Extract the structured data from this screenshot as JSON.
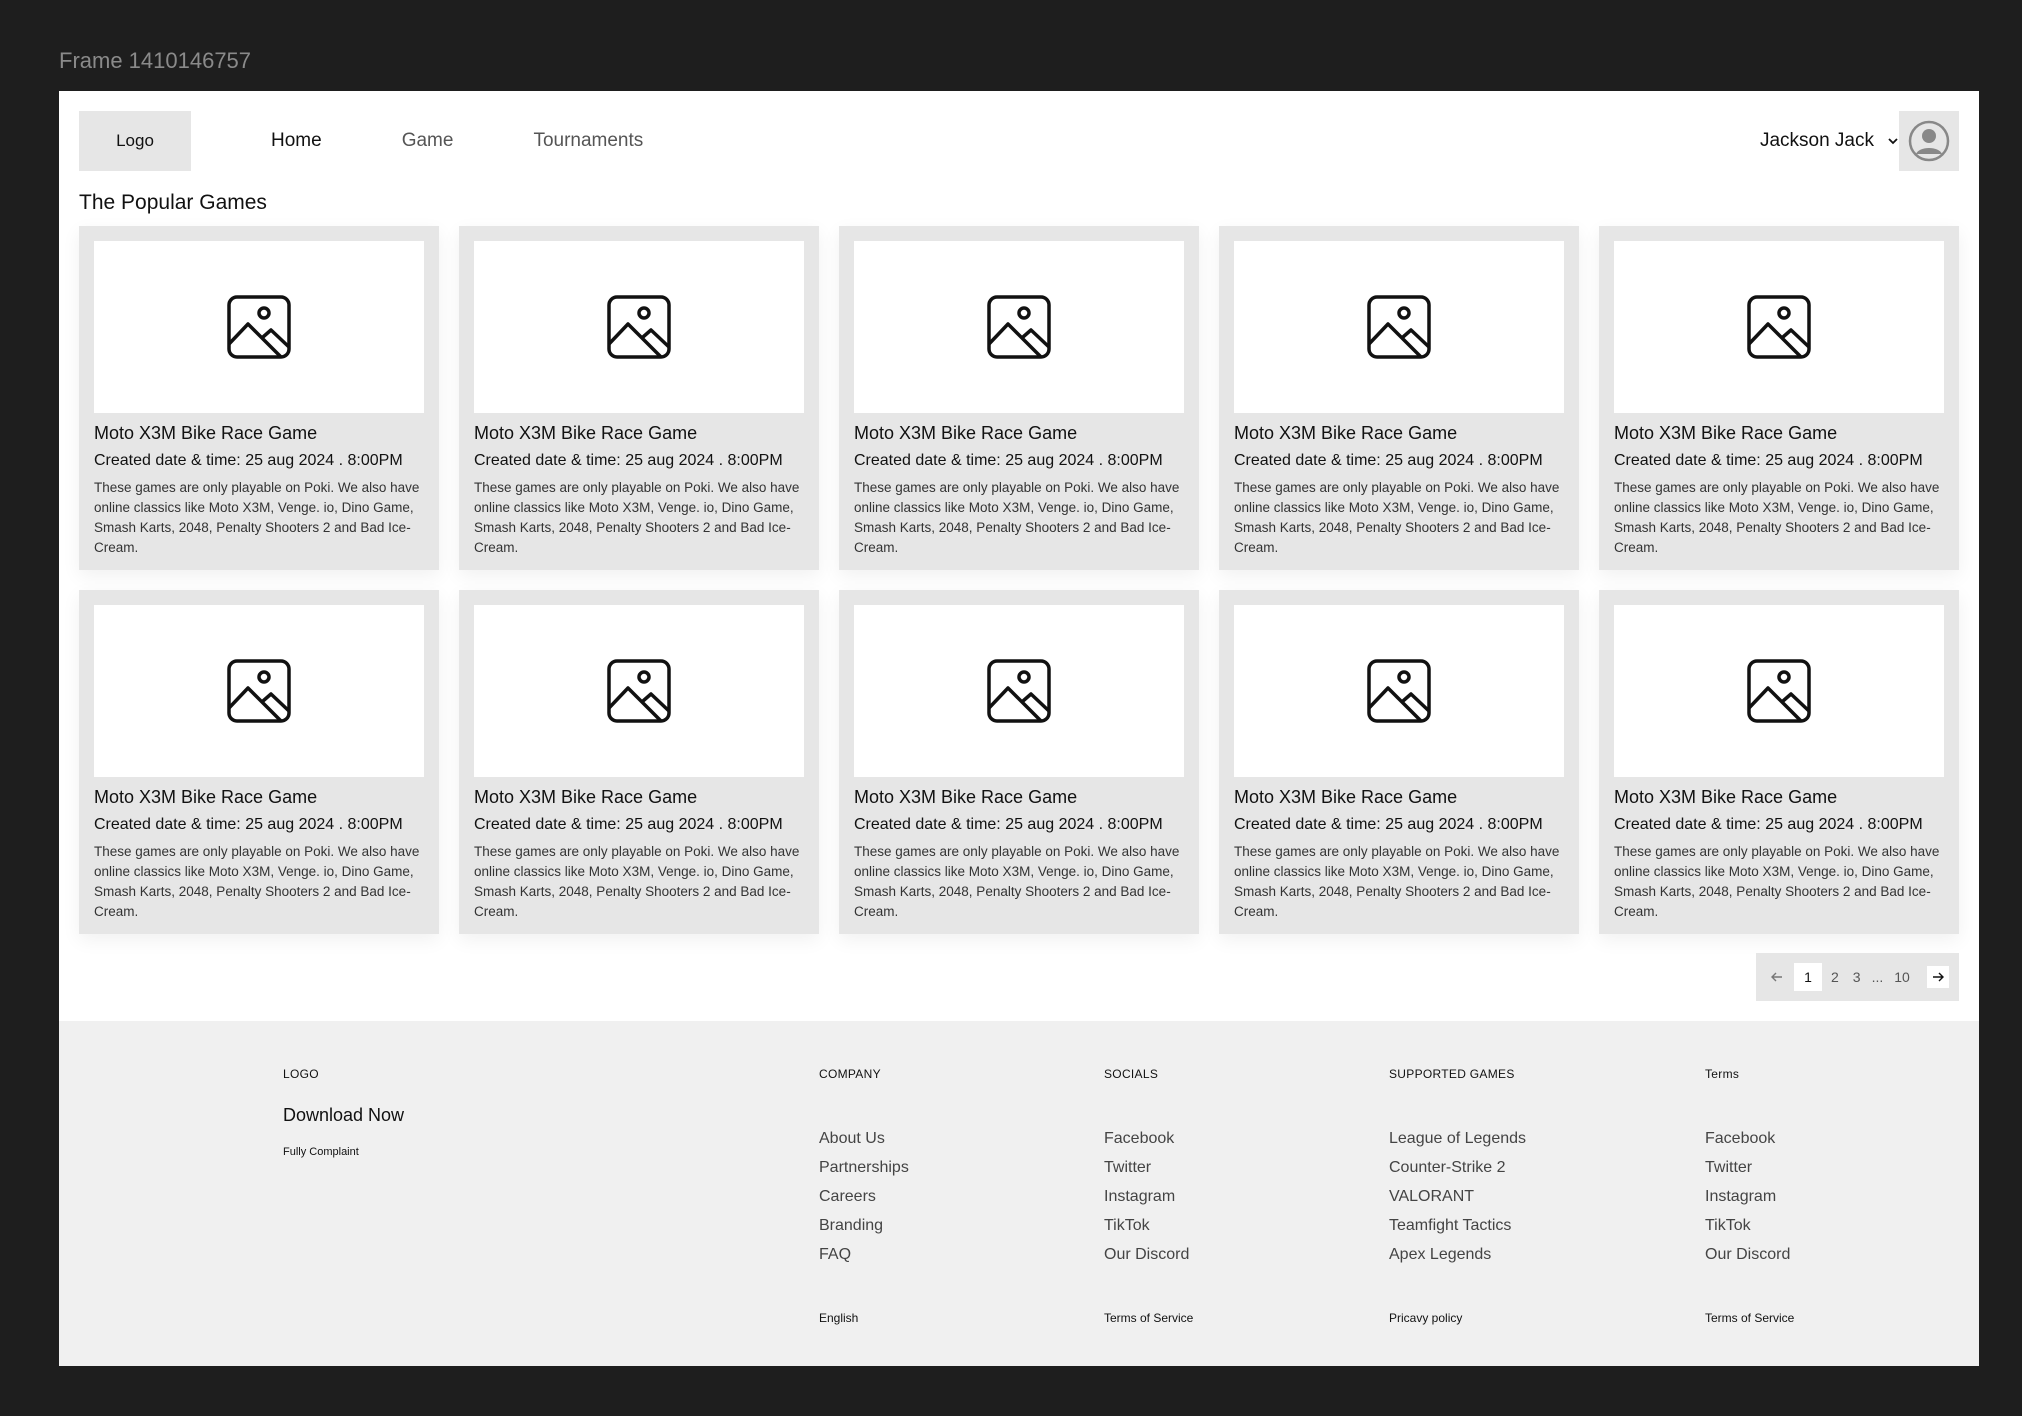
{
  "frame_label": "Frame 1410146757",
  "header": {
    "logo": "Logo",
    "nav": [
      "Home",
      "Game",
      "Tournaments"
    ],
    "active_nav": "Home",
    "user_name": "Jackson Jack"
  },
  "section_title": "The Popular Games",
  "cards": [
    {
      "title": "Moto X3M Bike Race Game",
      "date": "Created date & time: 25 aug 2024 . 8:00PM",
      "desc": "These games are only playable on Poki. We also have online classics like Moto X3M, Venge. io, Dino Game, Smash Karts, 2048, Penalty Shooters 2 and Bad Ice-Cream."
    },
    {
      "title": "Moto X3M Bike Race Game",
      "date": "Created date & time: 25 aug 2024 . 8:00PM",
      "desc": "These games are only playable on Poki. We also have online classics like Moto X3M, Venge. io, Dino Game, Smash Karts, 2048, Penalty Shooters 2 and Bad Ice-Cream."
    },
    {
      "title": "Moto X3M Bike Race Game",
      "date": "Created date & time: 25 aug 2024 . 8:00PM",
      "desc": "These games are only playable on Poki. We also have online classics like Moto X3M, Venge. io, Dino Game, Smash Karts, 2048, Penalty Shooters 2 and Bad Ice-Cream."
    },
    {
      "title": "Moto X3M Bike Race Game",
      "date": "Created date & time: 25 aug 2024 . 8:00PM",
      "desc": "These games are only playable on Poki. We also have online classics like Moto X3M, Venge. io, Dino Game, Smash Karts, 2048, Penalty Shooters 2 and Bad Ice-Cream."
    },
    {
      "title": "Moto X3M Bike Race Game",
      "date": "Created date & time: 25 aug 2024 . 8:00PM",
      "desc": "These games are only playable on Poki. We also have online classics like Moto X3M, Venge. io, Dino Game, Smash Karts, 2048, Penalty Shooters 2 and Bad Ice-Cream."
    },
    {
      "title": "Moto X3M Bike Race Game",
      "date": "Created date & time: 25 aug 2024 . 8:00PM",
      "desc": "These games are only playable on Poki. We also have online classics like Moto X3M, Venge. io, Dino Game, Smash Karts, 2048, Penalty Shooters 2 and Bad Ice-Cream."
    },
    {
      "title": "Moto X3M Bike Race Game",
      "date": "Created date & time: 25 aug 2024 . 8:00PM",
      "desc": "These games are only playable on Poki. We also have online classics like Moto X3M, Venge. io, Dino Game, Smash Karts, 2048, Penalty Shooters 2 and Bad Ice-Cream."
    },
    {
      "title": "Moto X3M Bike Race Game",
      "date": "Created date & time: 25 aug 2024 . 8:00PM",
      "desc": "These games are only playable on Poki. We also have online classics like Moto X3M, Venge. io, Dino Game, Smash Karts, 2048, Penalty Shooters 2 and Bad Ice-Cream."
    },
    {
      "title": "Moto X3M Bike Race Game",
      "date": "Created date & time: 25 aug 2024 . 8:00PM",
      "desc": "These games are only playable on Poki. We also have online classics like Moto X3M, Venge. io, Dino Game, Smash Karts, 2048, Penalty Shooters 2 and Bad Ice-Cream."
    },
    {
      "title": "Moto X3M Bike Race Game",
      "date": "Created date & time: 25 aug 2024 . 8:00PM",
      "desc": "These games are only playable on Poki. We also have online classics like Moto X3M, Venge. io, Dino Game, Smash Karts, 2048, Penalty Shooters 2 and Bad Ice-Cream."
    }
  ],
  "pagination": {
    "pages": [
      "1",
      "2",
      "3"
    ],
    "dots": "...",
    "last": "10",
    "current": "1"
  },
  "footer": {
    "logo": "LOGO",
    "download": "Download Now",
    "fully": "Fully Complaint",
    "columns": [
      {
        "head": "COMPANY",
        "links": [
          "About Us",
          "Partnerships",
          "Careers",
          "Branding",
          "FAQ"
        ],
        "bottom": "English"
      },
      {
        "head": "SOCIALS",
        "links": [
          "Facebook",
          "Twitter",
          "Instagram",
          "TikTok",
          "Our Discord"
        ],
        "bottom": "Terms of Service"
      },
      {
        "head": "SUPPORTED GAMES",
        "links": [
          "League of Legends",
          "Counter-Strike 2",
          "VALORANT",
          "Teamfight Tactics",
          "Apex Legends"
        ],
        "bottom": "Pricavy policy"
      },
      {
        "head": "Terms",
        "links": [
          "Facebook",
          "Twitter",
          "Instagram",
          "TikTok",
          "Our Discord"
        ],
        "bottom": "Terms of Service"
      }
    ]
  },
  "icons": {
    "thumbnail": "image-placeholder-icon",
    "avatar": "user-circle-icon",
    "chevron": "chevron-down-icon",
    "prev": "arrow-left-icon",
    "next": "arrow-right-icon"
  }
}
